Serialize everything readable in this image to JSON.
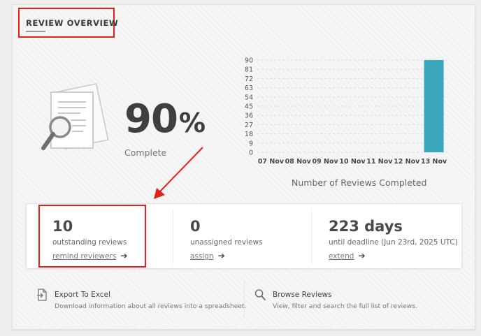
{
  "header": {
    "title": "REVIEW OVERVIEW"
  },
  "summary": {
    "percent": "90",
    "percent_symbol": "%",
    "caption": "Complete"
  },
  "chart_title": "Number of Reviews Completed",
  "chart_data": {
    "type": "bar",
    "categories": [
      "07 Nov",
      "08 Nov",
      "09 Nov",
      "10 Nov",
      "11 Nov",
      "12 Nov",
      "13 Nov"
    ],
    "values": [
      0,
      0,
      0,
      0,
      0,
      0,
      90
    ],
    "yticks": [
      0,
      9,
      18,
      27,
      36,
      45,
      54,
      63,
      72,
      81,
      90
    ],
    "ylim": [
      0,
      90
    ],
    "bar_color": "#3aa6b9",
    "grid": true,
    "title": "Number of Reviews Completed"
  },
  "stats": [
    {
      "value": "10",
      "label": "outstanding reviews",
      "link": "remind reviewers"
    },
    {
      "value": "0",
      "label": "unassigned reviews",
      "link": "assign"
    },
    {
      "value": "223 days",
      "label": "until deadline (Jun 23rd, 2025 UTC)",
      "link": "extend"
    }
  ],
  "actions": [
    {
      "icon": "export-icon",
      "title": "Export To Excel",
      "desc": "Download information about all reviews into a spreadsheet."
    },
    {
      "icon": "search-icon",
      "title": "Browse Reviews",
      "desc": "View, filter and search the full list of reviews."
    }
  ],
  "colors": {
    "accent": "#e3221c",
    "bar": "#3aa6b9"
  }
}
